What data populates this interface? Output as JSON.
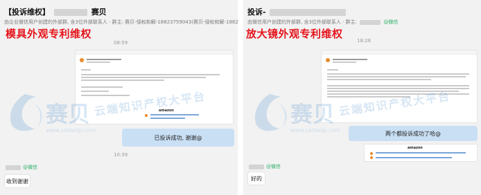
{
  "left": {
    "title_prefix": "【投诉维权】",
    "title_suffix": "赛贝",
    "subtitle": "由企业微信用户创建的外部群, 含3位外部联系人 · 群主: 赛贝-侵权和解-18823759043(赛贝-侵权和解-1882",
    "overlay_title": "模具外观专利维权",
    "time1": "08:59",
    "time2": "10:39",
    "bubble_sent": "已投诉成功, 谢谢@",
    "wechat_tag": "@微信",
    "reply": "收到谢谢"
  },
  "right": {
    "title_prefix": "投诉-",
    "subtitle": "由微信用户创建的外部群, 含3位外部联系人 · 群主:",
    "wechat_tag": "@微信",
    "overlay_title": "放大镜外观专利维权",
    "time1": "18:26",
    "bubble_sent": "两个都投诉成功了哈@",
    "reply": "好的"
  },
  "watermark": {
    "brand": "赛贝",
    "slogan": "云端知识产权大平台",
    "url": "www.saibeiip.com",
    "color": "#4a8fd1"
  },
  "email_preview": {
    "brand": "amazon"
  }
}
